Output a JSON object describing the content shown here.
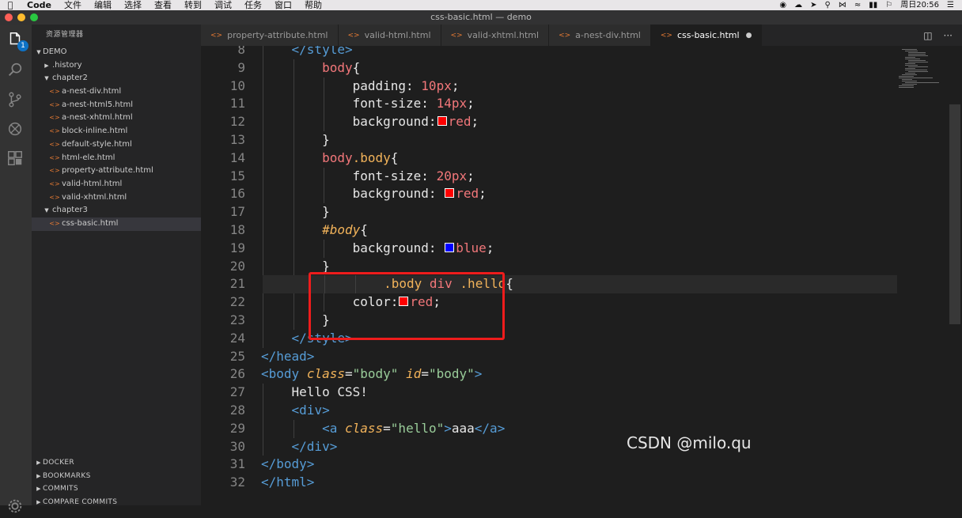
{
  "menubar": {
    "app_name": "Code",
    "items": [
      "文件",
      "编辑",
      "选择",
      "查看",
      "转到",
      "调试",
      "任务",
      "窗口",
      "帮助"
    ],
    "clock": "周日20:56"
  },
  "window": {
    "title": "css-basic.html — demo"
  },
  "activity": {
    "explorer_badge": "1"
  },
  "sidebar": {
    "title": "资源管理器",
    "root": "DEMO",
    "tree": [
      {
        "label": ".history",
        "kind": "folder",
        "depth": 1,
        "open": false
      },
      {
        "label": "chapter2",
        "kind": "folder",
        "depth": 1,
        "open": true
      },
      {
        "label": "a-nest-div.html",
        "kind": "file",
        "depth": 2
      },
      {
        "label": "a-nest-html5.html",
        "kind": "file",
        "depth": 2
      },
      {
        "label": "a-nest-xhtml.html",
        "kind": "file",
        "depth": 2
      },
      {
        "label": "block-inline.html",
        "kind": "file",
        "depth": 2
      },
      {
        "label": "default-style.html",
        "kind": "file",
        "depth": 2
      },
      {
        "label": "html-ele.html",
        "kind": "file",
        "depth": 2
      },
      {
        "label": "property-attribute.html",
        "kind": "file",
        "depth": 2
      },
      {
        "label": "valid-html.html",
        "kind": "file",
        "depth": 2
      },
      {
        "label": "valid-xhtml.html",
        "kind": "file",
        "depth": 2
      },
      {
        "label": "chapter3",
        "kind": "folder",
        "depth": 1,
        "open": true
      },
      {
        "label": "css-basic.html",
        "kind": "file",
        "depth": 2,
        "selected": true
      }
    ],
    "sections": [
      "DOCKER",
      "BOOKMARKS",
      "COMMITS",
      "COMPARE COMMITS"
    ]
  },
  "tabs": [
    {
      "label": "property-attribute.html",
      "active": false
    },
    {
      "label": "valid-html.html",
      "active": false
    },
    {
      "label": "valid-xhtml.html",
      "active": false
    },
    {
      "label": "a-nest-div.html",
      "active": false
    },
    {
      "label": "css-basic.html",
      "active": true,
      "dirty": true
    }
  ],
  "editor": {
    "current_line": 21,
    "lines": [
      {
        "n": "8",
        "indent": 1,
        "tokens": [
          [
            "</",
            "tag"
          ],
          [
            "style",
            "tag"
          ],
          [
            ">",
            "tag"
          ]
        ]
      },
      {
        "n": "9",
        "indent": 2,
        "tokens": [
          [
            "body",
            "sel"
          ],
          [
            "{",
            "pl"
          ]
        ]
      },
      {
        "n": "10",
        "indent": 3,
        "tokens": [
          [
            "padding",
            "prop"
          ],
          [
            ": ",
            "pl"
          ],
          [
            "10px",
            "num"
          ],
          [
            ";",
            "pl"
          ]
        ]
      },
      {
        "n": "11",
        "indent": 3,
        "tokens": [
          [
            "font-size",
            "prop"
          ],
          [
            ": ",
            "pl"
          ],
          [
            "14px",
            "num"
          ],
          [
            ";",
            "pl"
          ]
        ]
      },
      {
        "n": "12",
        "indent": 3,
        "tokens": [
          [
            "background",
            "prop"
          ],
          [
            ":",
            "pl"
          ],
          [
            "#ff0000",
            "swatch"
          ],
          [
            "red",
            "num"
          ],
          [
            ";",
            "pl"
          ]
        ]
      },
      {
        "n": "13",
        "indent": 2,
        "tokens": [
          [
            "}",
            "pl"
          ]
        ]
      },
      {
        "n": "14",
        "indent": 2,
        "tokens": [
          [
            "body",
            "sel"
          ],
          [
            ".body",
            "cls"
          ],
          [
            "{",
            "pl"
          ]
        ]
      },
      {
        "n": "15",
        "indent": 3,
        "tokens": [
          [
            "font-size",
            "prop"
          ],
          [
            ": ",
            "pl"
          ],
          [
            "20px",
            "num"
          ],
          [
            ";",
            "pl"
          ]
        ]
      },
      {
        "n": "16",
        "indent": 3,
        "tokens": [
          [
            "background",
            "prop"
          ],
          [
            ": ",
            "pl"
          ],
          [
            "#ff0000",
            "swatch"
          ],
          [
            "red",
            "num"
          ],
          [
            ";",
            "pl"
          ]
        ]
      },
      {
        "n": "17",
        "indent": 2,
        "tokens": [
          [
            "}",
            "pl"
          ]
        ]
      },
      {
        "n": "18",
        "indent": 2,
        "tokens": [
          [
            "#body",
            "id"
          ],
          [
            "{",
            "pl"
          ]
        ]
      },
      {
        "n": "19",
        "indent": 3,
        "tokens": [
          [
            "background",
            "prop"
          ],
          [
            ": ",
            "pl"
          ],
          [
            "#0000ff",
            "swatch"
          ],
          [
            "blue",
            "num"
          ],
          [
            ";",
            "pl"
          ]
        ]
      },
      {
        "n": "20",
        "indent": 2,
        "tokens": [
          [
            "}",
            "pl"
          ]
        ]
      },
      {
        "n": "21",
        "indent": 2,
        "tokens": [
          [
            ".body",
            "cls"
          ],
          [
            " ",
            "pl"
          ],
          [
            "div",
            "sel"
          ],
          [
            " ",
            "pl"
          ],
          [
            ".hello",
            "cls"
          ],
          [
            "{",
            "pl"
          ]
        ]
      },
      {
        "n": "22",
        "indent": 3,
        "tokens": [
          [
            "color",
            "prop"
          ],
          [
            ":",
            "pl"
          ],
          [
            "#ff0000",
            "swatch"
          ],
          [
            "red",
            "num"
          ],
          [
            ";",
            "pl"
          ]
        ]
      },
      {
        "n": "23",
        "indent": 2,
        "tokens": [
          [
            "}",
            "pl"
          ]
        ]
      },
      {
        "n": "24",
        "indent": 1,
        "tokens": [
          [
            "</",
            "tag"
          ],
          [
            "style",
            "tag"
          ],
          [
            ">",
            "tag"
          ]
        ]
      },
      {
        "n": "25",
        "indent": 0,
        "tokens": [
          [
            "</",
            "tag"
          ],
          [
            "head",
            "tag"
          ],
          [
            ">",
            "tag"
          ]
        ]
      },
      {
        "n": "26",
        "indent": 0,
        "tokens": [
          [
            "<",
            "tag"
          ],
          [
            "body",
            "tag"
          ],
          [
            " ",
            "pl"
          ],
          [
            "class",
            "attr"
          ],
          [
            "=",
            "pl"
          ],
          [
            "\"body\"",
            "str"
          ],
          [
            " ",
            "pl"
          ],
          [
            "id",
            "attr"
          ],
          [
            "=",
            "pl"
          ],
          [
            "\"body\"",
            "str"
          ],
          [
            ">",
            "tag"
          ]
        ]
      },
      {
        "n": "27",
        "indent": 1,
        "tokens": [
          [
            "Hello CSS!",
            "txt"
          ]
        ]
      },
      {
        "n": "28",
        "indent": 1,
        "tokens": [
          [
            "<",
            "tag"
          ],
          [
            "div",
            "tag"
          ],
          [
            ">",
            "tag"
          ]
        ]
      },
      {
        "n": "29",
        "indent": 2,
        "tokens": [
          [
            "<",
            "tag"
          ],
          [
            "a",
            "tag"
          ],
          [
            " ",
            "pl"
          ],
          [
            "class",
            "attr"
          ],
          [
            "=",
            "pl"
          ],
          [
            "\"hello\"",
            "str"
          ],
          [
            ">",
            "tag"
          ],
          [
            "aaa",
            "txt"
          ],
          [
            "</",
            "tag"
          ],
          [
            "a",
            "tag"
          ],
          [
            ">",
            "tag"
          ]
        ]
      },
      {
        "n": "30",
        "indent": 1,
        "tokens": [
          [
            "</",
            "tag"
          ],
          [
            "div",
            "tag"
          ],
          [
            ">",
            "tag"
          ]
        ]
      },
      {
        "n": "31",
        "indent": 0,
        "tokens": [
          [
            "</",
            "tag"
          ],
          [
            "body",
            "tag"
          ],
          [
            ">",
            "tag"
          ]
        ]
      },
      {
        "n": "32",
        "indent": 0,
        "tokens": [
          [
            "</",
            "tag"
          ],
          [
            "html",
            "tag"
          ],
          [
            ">",
            "tag"
          ]
        ]
      }
    ]
  },
  "colors": {
    "tag": "#569cd6",
    "sel": "#f2777a",
    "cls": "#f2b35a",
    "id": "#f2b35a",
    "prop": "#e6e6e6",
    "num": "#f2777a",
    "str": "#99cc99",
    "attr": "#f2b35a",
    "txt": "#e6e6e6",
    "pl": "#e6e6e6",
    "highlight": "#ee1c1c"
  },
  "watermark": "CSDN @milo.qu"
}
